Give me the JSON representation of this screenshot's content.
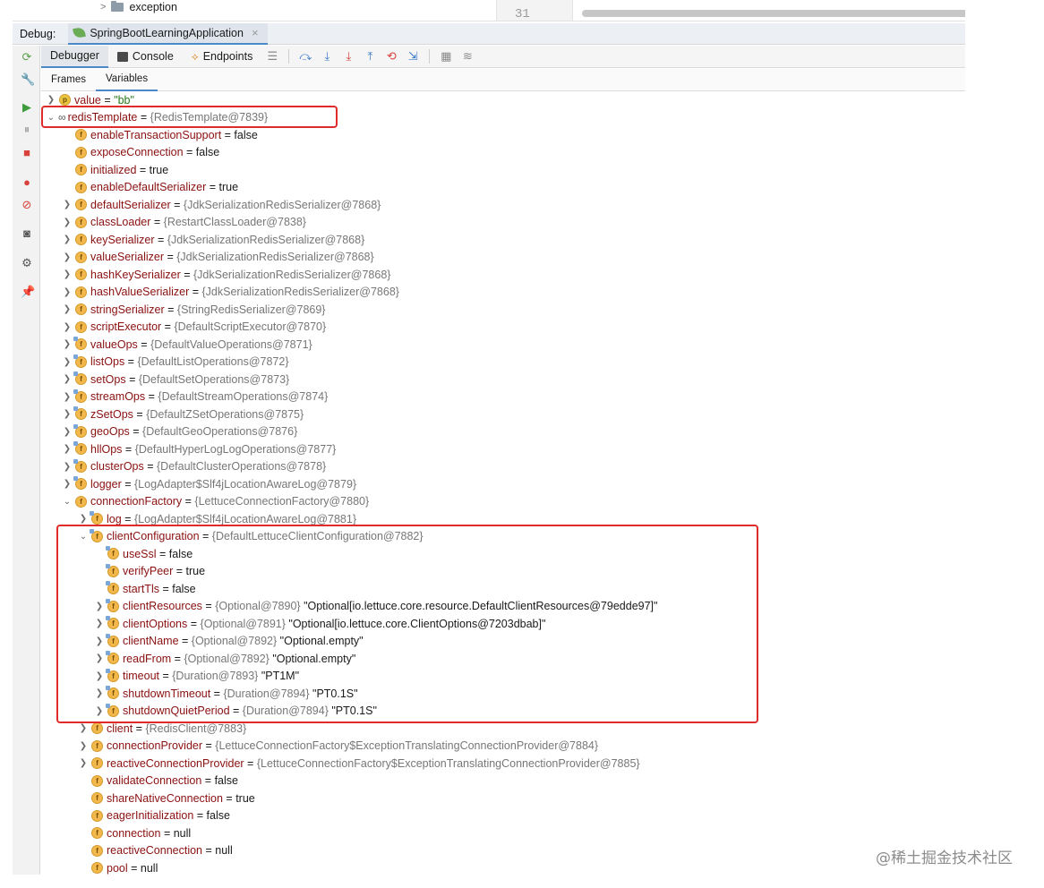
{
  "project_tree": {
    "visible_item": "exception",
    "gutter_line": "31"
  },
  "debug_header": {
    "label": "Debug:",
    "run_config": "SpringBootLearningApplication",
    "close_glyph": "×"
  },
  "toolbar": {
    "tabs": [
      {
        "label": "Debugger",
        "icon": ""
      },
      {
        "label": "Console",
        "icon": "console-icon"
      },
      {
        "label": "Endpoints",
        "icon": "endpoints-icon"
      }
    ],
    "buttons": [
      "menu-icon",
      "show-execution-point-icon",
      "step-over-icon",
      "step-into-icon",
      "force-step-into-icon",
      "step-out-icon",
      "drop-frame-icon",
      "run-to-cursor-icon",
      "evaluate-expression-icon",
      "trace-icon"
    ]
  },
  "subtabs": {
    "frames": "Frames",
    "variables": "Variables"
  },
  "left_bar_icons": [
    "rerun-icon",
    "settings-icon",
    "resume-icon",
    "pause-icon",
    "stop-icon",
    "view-breakpoints-icon",
    "mute-breakpoints-icon",
    "camera-icon",
    "gear-icon",
    "pin-icon"
  ],
  "variables": [
    {
      "arrow": ">",
      "badge": "p",
      "name": "value",
      "rest": " = ",
      "value": "\"bb\"",
      "value_kind": "strgreen",
      "level": 0
    },
    {
      "arrow": "v",
      "badge": "oo",
      "name": "redisTemplate",
      "rest": " = ",
      "value": "{RedisTemplate@7839}",
      "value_kind": "ref",
      "level": 0
    },
    {
      "arrow": "",
      "badge": "f",
      "name": "enableTransactionSupport",
      "rest": " = ",
      "value": "false",
      "value_kind": "str",
      "level": 1
    },
    {
      "arrow": "",
      "badge": "f",
      "name": "exposeConnection",
      "rest": " = ",
      "value": "false",
      "value_kind": "str",
      "level": 1
    },
    {
      "arrow": "",
      "badge": "f",
      "name": "initialized",
      "rest": " = ",
      "value": "true",
      "value_kind": "str",
      "level": 1
    },
    {
      "arrow": "",
      "badge": "f",
      "name": "enableDefaultSerializer",
      "rest": " = ",
      "value": "true",
      "value_kind": "str",
      "level": 1
    },
    {
      "arrow": ">",
      "badge": "f",
      "name": "defaultSerializer",
      "rest": " = ",
      "value": "{JdkSerializationRedisSerializer@7868}",
      "value_kind": "ref",
      "level": 1
    },
    {
      "arrow": ">",
      "badge": "f",
      "name": "classLoader",
      "rest": " = ",
      "value": "{RestartClassLoader@7838}",
      "value_kind": "ref",
      "level": 1
    },
    {
      "arrow": ">",
      "badge": "f",
      "name": "keySerializer",
      "rest": " = ",
      "value": "{JdkSerializationRedisSerializer@7868}",
      "value_kind": "ref",
      "level": 1
    },
    {
      "arrow": ">",
      "badge": "f",
      "name": "valueSerializer",
      "rest": " = ",
      "value": "{JdkSerializationRedisSerializer@7868}",
      "value_kind": "ref",
      "level": 1
    },
    {
      "arrow": ">",
      "badge": "f",
      "name": "hashKeySerializer",
      "rest": " = ",
      "value": "{JdkSerializationRedisSerializer@7868}",
      "value_kind": "ref",
      "level": 1
    },
    {
      "arrow": ">",
      "badge": "f",
      "name": "hashValueSerializer",
      "rest": " = ",
      "value": "{JdkSerializationRedisSerializer@7868}",
      "value_kind": "ref",
      "level": 1
    },
    {
      "arrow": ">",
      "badge": "f",
      "name": "stringSerializer",
      "rest": " = ",
      "value": "{StringRedisSerializer@7869}",
      "value_kind": "ref",
      "level": 1
    },
    {
      "arrow": ">",
      "badge": "f",
      "name": "scriptExecutor",
      "rest": " = ",
      "value": "{DefaultScriptExecutor@7870}",
      "value_kind": "ref",
      "level": 1
    },
    {
      "arrow": ">",
      "badge": "fs",
      "name": "valueOps",
      "rest": " = ",
      "value": "{DefaultValueOperations@7871}",
      "value_kind": "ref",
      "level": 1
    },
    {
      "arrow": ">",
      "badge": "fs",
      "name": "listOps",
      "rest": " = ",
      "value": "{DefaultListOperations@7872}",
      "value_kind": "ref",
      "level": 1
    },
    {
      "arrow": ">",
      "badge": "fs",
      "name": "setOps",
      "rest": " = ",
      "value": "{DefaultSetOperations@7873}",
      "value_kind": "ref",
      "level": 1
    },
    {
      "arrow": ">",
      "badge": "fs",
      "name": "streamOps",
      "rest": " = ",
      "value": "{DefaultStreamOperations@7874}",
      "value_kind": "ref",
      "level": 1
    },
    {
      "arrow": ">",
      "badge": "fs",
      "name": "zSetOps",
      "rest": " = ",
      "value": "{DefaultZSetOperations@7875}",
      "value_kind": "ref",
      "level": 1
    },
    {
      "arrow": ">",
      "badge": "fs",
      "name": "geoOps",
      "rest": " = ",
      "value": "{DefaultGeoOperations@7876}",
      "value_kind": "ref",
      "level": 1
    },
    {
      "arrow": ">",
      "badge": "fs",
      "name": "hllOps",
      "rest": " = ",
      "value": "{DefaultHyperLogLogOperations@7877}",
      "value_kind": "ref",
      "level": 1
    },
    {
      "arrow": ">",
      "badge": "fs",
      "name": "clusterOps",
      "rest": " = ",
      "value": "{DefaultClusterOperations@7878}",
      "value_kind": "ref",
      "level": 1
    },
    {
      "arrow": ">",
      "badge": "fs",
      "name": "logger",
      "rest": " = ",
      "value": "{LogAdapter$Slf4jLocationAwareLog@7879}",
      "value_kind": "ref",
      "level": 1
    },
    {
      "arrow": "v",
      "badge": "f",
      "name": "connectionFactory",
      "rest": " = ",
      "value": "{LettuceConnectionFactory@7880}",
      "value_kind": "ref",
      "level": 1
    },
    {
      "arrow": ">",
      "badge": "fs",
      "name": "log",
      "rest": " = ",
      "value": "{LogAdapter$Slf4jLocationAwareLog@7881}",
      "value_kind": "ref",
      "level": 2
    },
    {
      "arrow": "v",
      "badge": "fs",
      "name": "clientConfiguration",
      "rest": " = ",
      "value": "{DefaultLettuceClientConfiguration@7882}",
      "value_kind": "ref",
      "level": 2
    },
    {
      "arrow": "",
      "badge": "fs",
      "name": "useSsl",
      "rest": " = ",
      "value": "false",
      "value_kind": "str",
      "level": 3
    },
    {
      "arrow": "",
      "badge": "fs",
      "name": "verifyPeer",
      "rest": " = ",
      "value": "true",
      "value_kind": "str",
      "level": 3
    },
    {
      "arrow": "",
      "badge": "fs",
      "name": "startTls",
      "rest": " = ",
      "value": "false",
      "value_kind": "str",
      "level": 3
    },
    {
      "arrow": ">",
      "badge": "fs",
      "name": "clientResources",
      "rest": " = ",
      "value": "{Optional@7890}",
      "value_kind": "ref",
      "extra": " \"Optional[io.lettuce.core.resource.DefaultClientResources@79edde97]\"",
      "level": 3
    },
    {
      "arrow": ">",
      "badge": "fs",
      "name": "clientOptions",
      "rest": " = ",
      "value": "{Optional@7891}",
      "value_kind": "ref",
      "extra": " \"Optional[io.lettuce.core.ClientOptions@7203dbab]\"",
      "level": 3
    },
    {
      "arrow": ">",
      "badge": "fs",
      "name": "clientName",
      "rest": " = ",
      "value": "{Optional@7892}",
      "value_kind": "ref",
      "extra": " \"Optional.empty\"",
      "level": 3
    },
    {
      "arrow": ">",
      "badge": "fs",
      "name": "readFrom",
      "rest": " = ",
      "value": "{Optional@7892}",
      "value_kind": "ref",
      "extra": " \"Optional.empty\"",
      "level": 3
    },
    {
      "arrow": ">",
      "badge": "fs",
      "name": "timeout",
      "rest": " = ",
      "value": "{Duration@7893}",
      "value_kind": "ref",
      "extra": " \"PT1M\"",
      "level": 3
    },
    {
      "arrow": ">",
      "badge": "fs",
      "name": "shutdownTimeout",
      "rest": " = ",
      "value": "{Duration@7894}",
      "value_kind": "ref",
      "extra": " \"PT0.1S\"",
      "level": 3
    },
    {
      "arrow": ">",
      "badge": "fs",
      "name": "shutdownQuietPeriod",
      "rest": " = ",
      "value": "{Duration@7894}",
      "value_kind": "ref",
      "extra": " \"PT0.1S\"",
      "level": 3
    },
    {
      "arrow": ">",
      "badge": "f",
      "name": "client",
      "rest": " = ",
      "value": "{RedisClient@7883}",
      "value_kind": "ref",
      "level": 2
    },
    {
      "arrow": ">",
      "badge": "f",
      "name": "connectionProvider",
      "rest": " = ",
      "value": "{LettuceConnectionFactory$ExceptionTranslatingConnectionProvider@7884}",
      "value_kind": "ref",
      "level": 2
    },
    {
      "arrow": ">",
      "badge": "f",
      "name": "reactiveConnectionProvider",
      "rest": " = ",
      "value": "{LettuceConnectionFactory$ExceptionTranslatingConnectionProvider@7885}",
      "value_kind": "ref",
      "level": 2
    },
    {
      "arrow": "",
      "badge": "f",
      "name": "validateConnection",
      "rest": " = ",
      "value": "false",
      "value_kind": "str",
      "level": 2
    },
    {
      "arrow": "",
      "badge": "f",
      "name": "shareNativeConnection",
      "rest": " = ",
      "value": "true",
      "value_kind": "str",
      "level": 2
    },
    {
      "arrow": "",
      "badge": "f",
      "name": "eagerInitialization",
      "rest": " = ",
      "value": "false",
      "value_kind": "str",
      "level": 2
    },
    {
      "arrow": "",
      "badge": "f",
      "name": "connection",
      "rest": " = ",
      "value": "null",
      "value_kind": "str",
      "level": 2
    },
    {
      "arrow": "",
      "badge": "f",
      "name": "reactiveConnection",
      "rest": " = ",
      "value": "null",
      "value_kind": "str",
      "level": 2
    },
    {
      "arrow": "",
      "badge": "f",
      "name": "pool",
      "rest": " = ",
      "value": "null",
      "value_kind": "str",
      "level": 2
    }
  ],
  "watermark": "@稀土掘金技术社区"
}
